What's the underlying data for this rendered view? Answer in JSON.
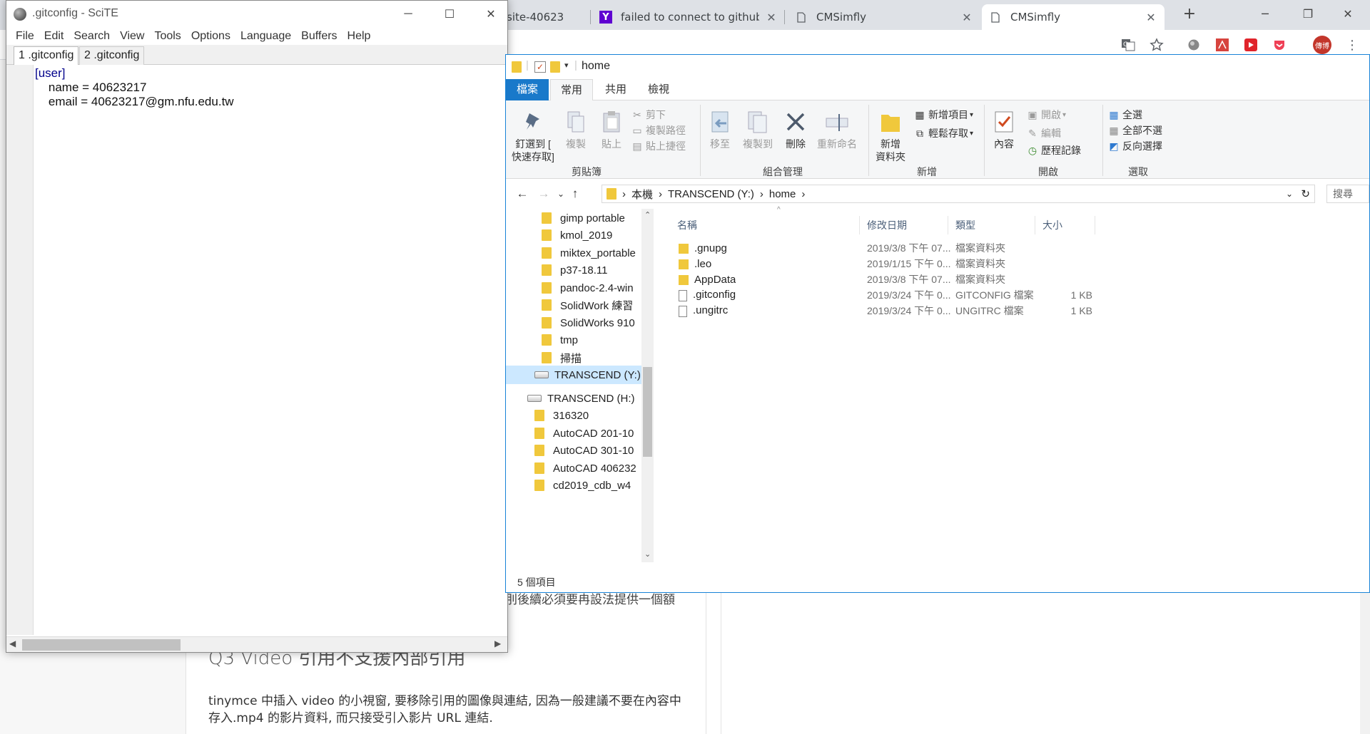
{
  "browser": {
    "tabs": [
      {
        "label": "site-40623",
        "active": false
      },
      {
        "label": "failed to connect to github",
        "active": false
      },
      {
        "label": "CMSimfly",
        "active": false
      },
      {
        "label": "CMSimfly",
        "active": true
      }
    ],
    "new_tab_glyph": "+",
    "user_badge": "傳博"
  },
  "article": {
    "fragment_line": "刖後續必須要冉設法提供一個額",
    "heading": "Q3 Video 引用不支援內部引用",
    "paragraph_line1": "tinymce 中插入 video 的小視窗, 要移除引用的圖像與連結, 因為一般建議不要在內容中",
    "paragraph_line2": "存入.mp4 的影片資料, 而只接受引入影片 URL 連結."
  },
  "scite": {
    "title": ".gitconfig - SciTE",
    "menu": [
      "File",
      "Edit",
      "Search",
      "View",
      "Tools",
      "Options",
      "Language",
      "Buffers",
      "Help"
    ],
    "tabs": [
      "1 .gitconfig",
      "2 .gitconfig"
    ],
    "code_lines": [
      "[user]",
      "    name = 40623217",
      "    email = 40623217@gm.nfu.edu.tw"
    ]
  },
  "explorer": {
    "title": "home",
    "ribbon_tabs": [
      "檔案",
      "常用",
      "共用",
      "檢視"
    ],
    "clipboard": {
      "pin_label_1": "釘選到 [",
      "pin_label_2": "快速存取]",
      "copy": "複製",
      "paste": "貼上",
      "cut": "剪下",
      "copy_path": "複製路徑",
      "paste_shortcut": "貼上捷徑",
      "group": "剪貼簿"
    },
    "organize": {
      "move_to": "移至",
      "copy_to": "複製到",
      "delete": "刪除",
      "rename": "重新命名",
      "group": "組合管理"
    },
    "new": {
      "new_folder_1": "新增",
      "new_folder_2": "資料夾",
      "new_item": "新增項目",
      "easy_access": "輕鬆存取",
      "group": "新增"
    },
    "open": {
      "properties": "內容",
      "open": "開啟",
      "edit": "編輯",
      "history": "歷程記錄",
      "group": "開啟"
    },
    "select": {
      "select_all": "全選",
      "select_none": "全部不選",
      "invert": "反向選擇",
      "group": "選取"
    },
    "breadcrumb": [
      "本機",
      "TRANSCEND (Y:)",
      "home"
    ],
    "search_placeholder": "搜尋",
    "tree": [
      {
        "label": "gimp portable",
        "type": "folder"
      },
      {
        "label": "kmol_2019",
        "type": "folder"
      },
      {
        "label": "miktex_portable",
        "type": "folder"
      },
      {
        "label": "p37-18.11",
        "type": "folder"
      },
      {
        "label": "pandoc-2.4-win",
        "type": "folder"
      },
      {
        "label": "SolidWork 練習",
        "type": "folder"
      },
      {
        "label": "SolidWorks 910",
        "type": "folder"
      },
      {
        "label": "tmp",
        "type": "folder"
      },
      {
        "label": "掃描",
        "type": "folder"
      },
      {
        "label": "TRANSCEND (Y:)",
        "type": "drive",
        "selected": true
      },
      {
        "label": "TRANSCEND (H:)",
        "type": "drive"
      },
      {
        "label": "316320",
        "type": "folder"
      },
      {
        "label": "AutoCAD 201-10",
        "type": "folder"
      },
      {
        "label": "AutoCAD 301-10",
        "type": "folder"
      },
      {
        "label": "AutoCAD 406232",
        "type": "folder"
      },
      {
        "label": "cd2019_cdb_w4",
        "type": "folder"
      }
    ],
    "columns": [
      "名稱",
      "修改日期",
      "類型",
      "大小"
    ],
    "files": [
      {
        "name": ".gnupg",
        "date": "2019/3/8 下午 07...",
        "type": "檔案資料夾",
        "size": "",
        "kind": "folder"
      },
      {
        "name": ".leo",
        "date": "2019/1/15 下午 0...",
        "type": "檔案資料夾",
        "size": "",
        "kind": "folder"
      },
      {
        "name": "AppData",
        "date": "2019/3/8 下午 07...",
        "type": "檔案資料夾",
        "size": "",
        "kind": "folder"
      },
      {
        "name": ".gitconfig",
        "date": "2019/3/24 下午 0...",
        "type": "GITCONFIG 檔案",
        "size": "1 KB",
        "kind": "file"
      },
      {
        "name": ".ungitrc",
        "date": "2019/3/24 下午 0...",
        "type": "UNGITRC 檔案",
        "size": "1 KB",
        "kind": "file"
      }
    ],
    "status": "5 個項目"
  }
}
